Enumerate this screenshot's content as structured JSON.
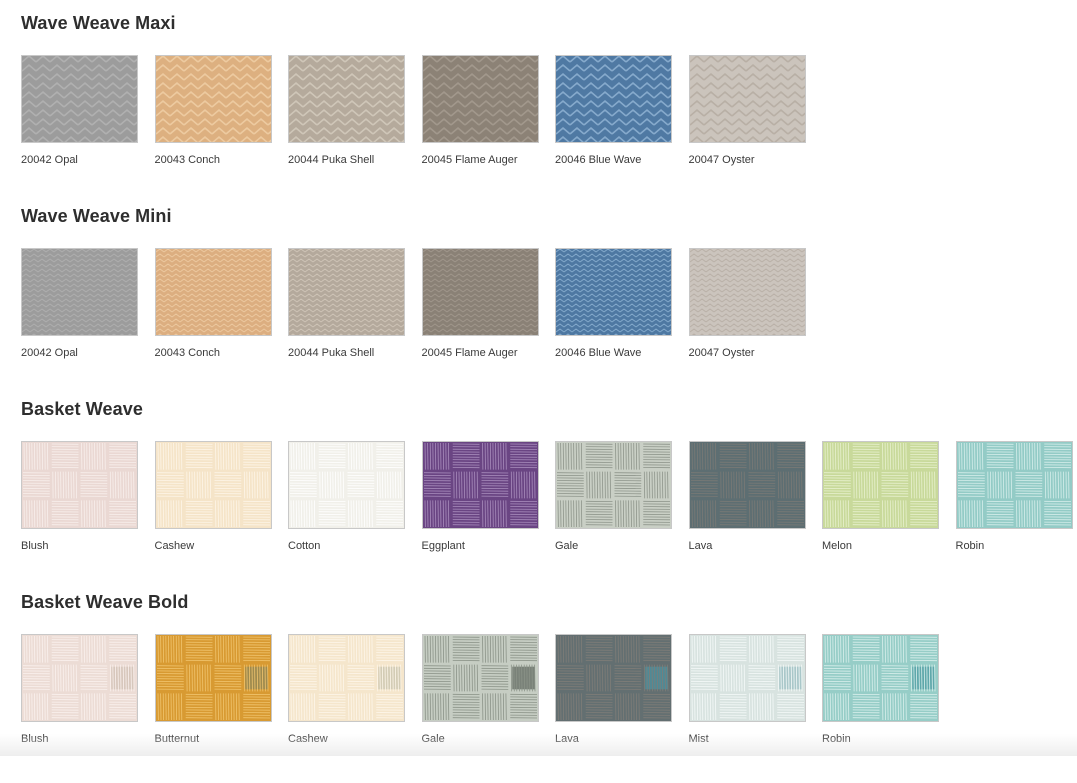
{
  "sections": [
    {
      "title": "Wave Weave Maxi",
      "pattern": "wave-maxi",
      "swatches": [
        {
          "label": "20042 Opal",
          "base": "#9c9c9c",
          "line": "#b4b4b4"
        },
        {
          "label": "20043 Conch",
          "base": "#ddb080",
          "line": "#f0cfa6"
        },
        {
          "label": "20044 Puka Shell",
          "base": "#b5aa9c",
          "line": "#d4cbbd"
        },
        {
          "label": "20045 Flame Auger",
          "base": "#8c8276",
          "line": "#a69c90"
        },
        {
          "label": "20046 Blue Wave",
          "base": "#4f79a3",
          "line": "#8fb3d4"
        },
        {
          "label": "20047 Oyster",
          "base": "#cbc4bc",
          "line": "#b5aca1"
        }
      ]
    },
    {
      "title": "Wave Weave Mini",
      "pattern": "wave-mini",
      "swatches": [
        {
          "label": "20042 Opal",
          "base": "#9c9c9c",
          "line": "#b2b2b2"
        },
        {
          "label": "20043 Conch",
          "base": "#dcae80",
          "line": "#efcca4"
        },
        {
          "label": "20044 Puka Shell",
          "base": "#b4a99c",
          "line": "#d2c8bb"
        },
        {
          "label": "20045 Flame Auger",
          "base": "#8a8176",
          "line": "#a39a8f"
        },
        {
          "label": "20046 Blue Wave",
          "base": "#4e78a2",
          "line": "#8db1d2"
        },
        {
          "label": "20047 Oyster",
          "base": "#cbc4bd",
          "line": "#b6ada3"
        }
      ]
    },
    {
      "title": "Basket Weave",
      "pattern": "basket",
      "swatches": [
        {
          "label": "Blush",
          "base": "#ead8d3",
          "line": "#f8efec"
        },
        {
          "label": "Cashew",
          "base": "#f5e4c8",
          "line": "#fdf5e8"
        },
        {
          "label": "Cotton",
          "base": "#f1f0ea",
          "line": "#ffffff"
        },
        {
          "label": "Eggplant",
          "base": "#6a4583",
          "line": "#a88cbc"
        },
        {
          "label": "Gale",
          "base": "#c9cfc5",
          "line": "#8e958b"
        },
        {
          "label": "Lava",
          "base": "#5d6e72",
          "line": "#7a7a76"
        },
        {
          "label": "Melon",
          "base": "#c8d99a",
          "line": "#e8f1cf"
        },
        {
          "label": "Robin",
          "base": "#93cbc6",
          "line": "#d6eeeb"
        }
      ]
    },
    {
      "title": "Basket Weave Bold",
      "pattern": "basket-bold",
      "swatches": [
        {
          "label": "Blush",
          "base": "#ecdcd5",
          "line": "#faf1ee",
          "accent": "#d7c7bc"
        },
        {
          "label": "Butternut",
          "base": "#d89a32",
          "line": "#f0c46e",
          "accent": "#9e8a4e"
        },
        {
          "label": "Cashew",
          "base": "#f5e6cc",
          "line": "#fdf6ea",
          "accent": "#d3ccb5"
        },
        {
          "label": "Gale",
          "base": "#c6cdc3",
          "line": "#8b9388",
          "accent": "#7a8279"
        },
        {
          "label": "Lava",
          "base": "#636f71",
          "line": "#7f7d78",
          "accent": "#4f8a96"
        },
        {
          "label": "Mist",
          "base": "#d8e3e0",
          "line": "#f4f9f8",
          "accent": "#a9c7c9"
        },
        {
          "label": "Robin",
          "base": "#96cdc7",
          "line": "#d9efec",
          "accent": "#5fa8ab"
        }
      ]
    }
  ]
}
